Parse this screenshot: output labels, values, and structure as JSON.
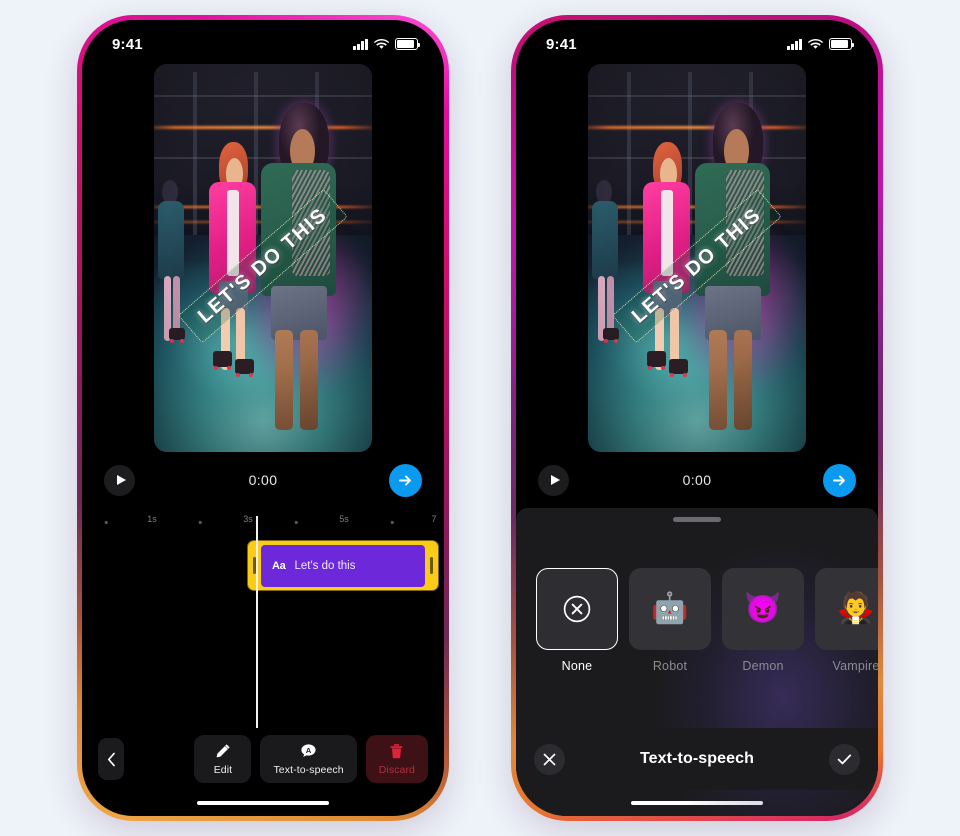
{
  "app": {
    "background_color": "#eef2f9",
    "accent_blue": "#0a9bf0",
    "clip_yellow": "#facc15",
    "clip_purple": "#6d28d9",
    "danger_red": "#b1303d"
  },
  "status_bar": {
    "time": "9:41",
    "cellular_icon": "signal-bars-icon",
    "wifi_icon": "wifi-icon",
    "battery_icon": "battery-icon"
  },
  "preview": {
    "sticker_text": "LET'S DO THIS",
    "scene_description": "roller-rink"
  },
  "transport": {
    "play_icon": "play-icon",
    "timecode": "0:00",
    "next_icon": "arrow-right-icon"
  },
  "timeline": {
    "ticks": [
      {
        "label": "",
        "pos": 6,
        "type": "dot"
      },
      {
        "label": "1s",
        "pos": 24,
        "type": "label"
      },
      {
        "label": "",
        "pos": 41,
        "type": "dot"
      },
      {
        "label": "3s",
        "pos": 56,
        "type": "label"
      },
      {
        "label": "",
        "pos": 72,
        "type": "dot"
      },
      {
        "label": "5s",
        "pos": 87,
        "type": "label"
      },
      {
        "label": "",
        "pos": 101,
        "type": "dot"
      },
      {
        "label": "7",
        "pos": 113,
        "type": "label"
      }
    ],
    "clip": {
      "type_icon": "Aa",
      "label": "Let's do this"
    }
  },
  "action_bar": {
    "back_icon": "chevron-left-icon",
    "actions": [
      {
        "label": "Edit",
        "icon": "pencil-icon",
        "variant": "normal"
      },
      {
        "label": "Text-to-speech",
        "icon": "speech-bubble-a-icon",
        "variant": "normal"
      },
      {
        "label": "Discard",
        "icon": "trash-icon",
        "variant": "danger"
      }
    ]
  },
  "voice_sheet": {
    "grabber": "sheet-grabber",
    "title": "Text-to-speech",
    "cancel_icon": "close-x-icon",
    "confirm_icon": "checkmark-icon",
    "voices": [
      {
        "name": "None",
        "emoji": "⊗",
        "icon": "none-circle-x-icon",
        "selected": true
      },
      {
        "name": "Robot",
        "emoji": "🤖",
        "icon": "robot-emoji",
        "selected": false
      },
      {
        "name": "Demon",
        "emoji": "😈",
        "icon": "demon-emoji",
        "selected": false
      },
      {
        "name": "Vampire",
        "emoji": "🧛",
        "icon": "vampire-emoji",
        "selected": false
      }
    ]
  }
}
